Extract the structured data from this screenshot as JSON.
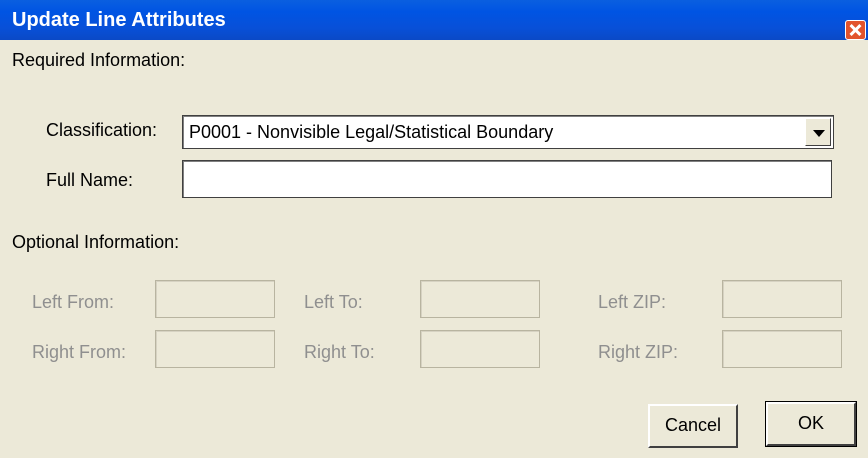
{
  "window": {
    "title": "Update Line Attributes"
  },
  "required": {
    "heading": "Required Information:",
    "classification_label": "Classification:",
    "classification_value": "P0001 - Nonvisible Legal/Statistical Boundary",
    "full_name_label": "Full Name:",
    "full_name_value": ""
  },
  "optional": {
    "heading": "Optional Information:",
    "left_from_label": "Left From:",
    "left_to_label": "Left To:",
    "left_zip_label": "Left ZIP:",
    "right_from_label": "Right From:",
    "right_to_label": "Right To:",
    "right_zip_label": "Right ZIP:"
  },
  "buttons": {
    "cancel_label": "Cancel",
    "ok_label": "OK"
  },
  "colors": {
    "titlebar": "#0054e3",
    "dialog_bg": "#ECE9D8",
    "disabled_text": "#8f8f8f"
  }
}
